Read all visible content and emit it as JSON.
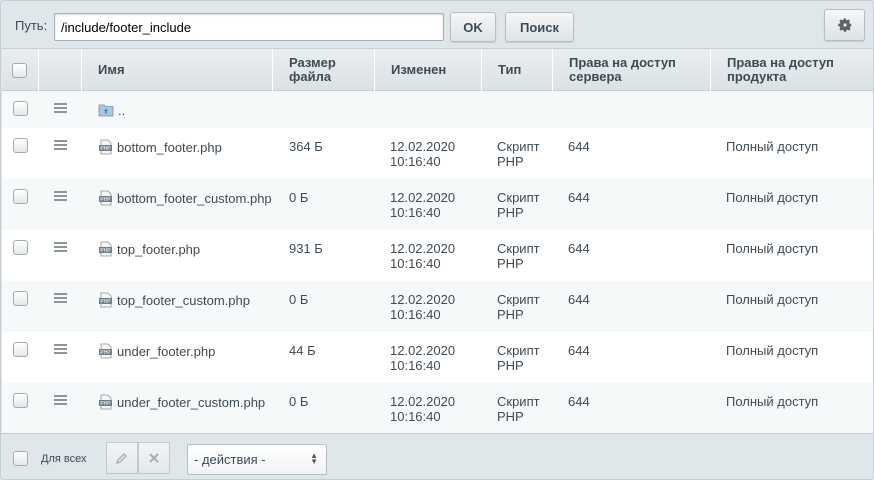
{
  "toolbar": {
    "path_label": "Путь:",
    "path_value": "/include/footer_include",
    "ok_label": "OK",
    "search_label": "Поиск",
    "settings_icon": "gear-icon"
  },
  "table": {
    "headers": {
      "name": "Имя",
      "size": "Размер файла",
      "modified": "Изменен",
      "type": "Тип",
      "server_rights": "Права на доступ сервера",
      "product_rights": "Права на доступ продукта"
    },
    "parent_row": {
      "label": "..",
      "icon": "folder-up-icon"
    },
    "rows": [
      {
        "name": "bottom_footer.php",
        "size": "364 Б",
        "date": "12.02.2020",
        "time": "10:16:40",
        "type1": "Скрипт",
        "type2": "PHP",
        "server_rights": "644",
        "product_rights": "Полный доступ"
      },
      {
        "name": "bottom_footer_custom.php",
        "size": "0 Б",
        "date": "12.02.2020",
        "time": "10:16:40",
        "type1": "Скрипт",
        "type2": "PHP",
        "server_rights": "644",
        "product_rights": "Полный доступ"
      },
      {
        "name": "top_footer.php",
        "size": "931 Б",
        "date": "12.02.2020",
        "time": "10:16:40",
        "type1": "Скрипт",
        "type2": "PHP",
        "server_rights": "644",
        "product_rights": "Полный доступ"
      },
      {
        "name": "top_footer_custom.php",
        "size": "0 Б",
        "date": "12.02.2020",
        "time": "10:16:40",
        "type1": "Скрипт",
        "type2": "PHP",
        "server_rights": "644",
        "product_rights": "Полный доступ"
      },
      {
        "name": "under_footer.php",
        "size": "44 Б",
        "date": "12.02.2020",
        "time": "10:16:40",
        "type1": "Скрипт",
        "type2": "PHP",
        "server_rights": "644",
        "product_rights": "Полный доступ"
      },
      {
        "name": "under_footer_custom.php",
        "size": "0 Б",
        "date": "12.02.2020",
        "time": "10:16:40",
        "type1": "Скрипт",
        "type2": "PHP",
        "server_rights": "644",
        "product_rights": "Полный доступ"
      }
    ]
  },
  "footer": {
    "for_all_label": "Для всех",
    "edit_icon": "pencil-icon",
    "delete_icon": "close-icon",
    "actions_value": "- действия -"
  }
}
